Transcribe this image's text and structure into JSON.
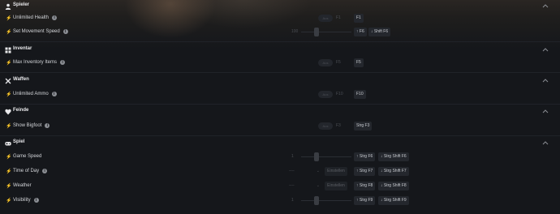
{
  "sections": {
    "spieler": {
      "title": "Spieler",
      "icon": "user-icon",
      "unlimited_health": {
        "label": "Unlimited Health",
        "toggle_text": "Aus",
        "toggle_key_hint": "F1",
        "hotkey": "F1"
      },
      "movement_speed": {
        "label": "Set Movement Speed",
        "value": "100",
        "inc_key": "F6",
        "dec_key": "Shift F6"
      }
    },
    "inventar": {
      "title": "Inventar",
      "icon": "grid-icon",
      "max_inventory": {
        "label": "Max Inventory Items",
        "toggle_text": "Aus",
        "toggle_key_hint": "F5",
        "hotkey": "F5"
      }
    },
    "waffen": {
      "title": "Waffen",
      "icon": "crossed-swords-icon",
      "unlimited_ammo": {
        "label": "Unlimited Ammo",
        "toggle_text": "Aus",
        "toggle_key_hint": "F10",
        "hotkey": "F10"
      }
    },
    "feinde": {
      "title": "Feinde",
      "icon": "heart-shield-icon",
      "show_bigfoot": {
        "label": "Show Bigfoot",
        "toggle_text": "Aus",
        "toggle_key_hint": "F3",
        "hotkey": "Strg F3"
      }
    },
    "spiel": {
      "title": "Spiel",
      "icon": "gamepad-icon",
      "game_speed": {
        "label": "Game Speed",
        "value": "1",
        "inc_key": "Strg F6",
        "dec_key": "Strg Shift F6"
      },
      "time_of_day": {
        "label": "Time of Day",
        "select_value": "----",
        "apply_label": "Einstellen",
        "inc_key": "Strg F7",
        "dec_key": "Strg Shift F7"
      },
      "weather": {
        "label": "Weather",
        "select_value": "----",
        "apply_label": "Einstellen",
        "inc_key": "Strg F8",
        "dec_key": "Strg Shift F8"
      },
      "visibility": {
        "label": "Visibility",
        "value": "1",
        "inc_key": "Strg F9",
        "dec_key": "Strg Shift F9"
      }
    }
  },
  "arrows": {
    "up": "↑",
    "down": "↓"
  },
  "colors": {
    "background": "#15171b",
    "text": "#d3d5d9",
    "key_bg": "#24272d"
  }
}
